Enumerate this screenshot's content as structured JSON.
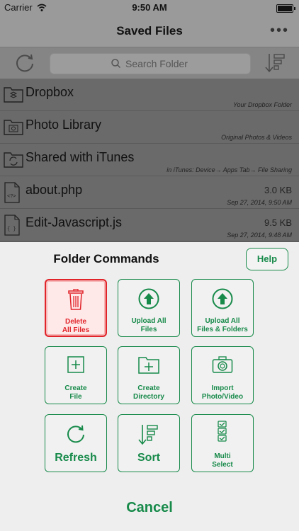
{
  "status": {
    "carrier": "Carrier",
    "time": "9:50 AM"
  },
  "nav": {
    "title": "Saved Files",
    "more": "•••"
  },
  "search": {
    "placeholder": "Search Folder"
  },
  "files": [
    {
      "name": "Dropbox",
      "sub": "Your Dropbox Folder",
      "icon": "dropbox-folder-icon"
    },
    {
      "name": "Photo Library",
      "sub": "Original Photos & Videos",
      "icon": "photo-folder-icon"
    },
    {
      "name": "Shared with iTunes",
      "sub": "in iTunes: Device→ Apps Tab→ File Sharing",
      "icon": "sync-folder-icon"
    },
    {
      "name": "about.php",
      "size": "3.0 KB",
      "sub": "Sep 27, 2014, 9:50 AM",
      "icon": "php-file-icon"
    },
    {
      "name": "Edit-Javascript.js",
      "size": "9.5 KB",
      "sub": "Sep 27, 2014, 9:48 AM",
      "icon": "js-file-icon"
    }
  ],
  "panel": {
    "title": "Folder Commands",
    "help": "Help",
    "commands": [
      {
        "l1": "Delete",
        "l2": "All Files",
        "icon": "trash-icon"
      },
      {
        "l1": "Upload All",
        "l2": "Files",
        "icon": "upload-icon"
      },
      {
        "l1": "Upload All",
        "l2": "Files & Folders",
        "icon": "upload-icon"
      },
      {
        "l1": "Create",
        "l2": "File",
        "icon": "new-file-icon"
      },
      {
        "l1": "Create",
        "l2": "Directory",
        "icon": "new-folder-icon"
      },
      {
        "l1": "Import",
        "l2": "Photo/Video",
        "icon": "camera-icon"
      },
      {
        "l1": "Refresh",
        "icon": "refresh-icon"
      },
      {
        "l1": "Sort",
        "icon": "sort-icon"
      },
      {
        "l1": "Multi",
        "l2": "Select",
        "icon": "checklist-icon"
      }
    ],
    "cancel": "Cancel"
  },
  "colors": {
    "accent": "#178a4a",
    "danger": "#e0242a"
  }
}
